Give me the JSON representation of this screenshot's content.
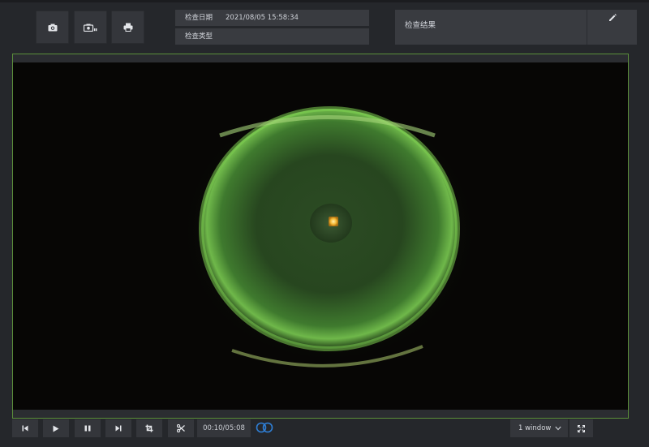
{
  "toolbar": {
    "buttons": [
      {
        "id": "capture",
        "icon": "camera-icon"
      },
      {
        "id": "record",
        "icon": "camera-record-icon"
      },
      {
        "id": "print",
        "icon": "printer-icon"
      }
    ]
  },
  "exam_info": {
    "date_label": "检查日期",
    "date_value": "2021/08/05 15:58:34",
    "type_label": "检查类型",
    "type_value": ""
  },
  "result": {
    "label": "检查结果",
    "edit_icon": "pencil-icon"
  },
  "player": {
    "buttons": [
      {
        "id": "prev",
        "icon": "skip-previous-icon"
      },
      {
        "id": "play",
        "icon": "play-icon"
      },
      {
        "id": "pause",
        "icon": "pause-icon"
      },
      {
        "id": "next",
        "icon": "skip-next-icon"
      },
      {
        "id": "crop",
        "icon": "crop-icon"
      },
      {
        "id": "cut",
        "icon": "scissors-icon"
      }
    ],
    "time": "00:10/05:08",
    "loop_icon": "loop-icon",
    "window_select": "1 window",
    "fullscreen_icon": "fullscreen-icon"
  },
  "colors": {
    "background": "#25272b",
    "panel": "#393b40",
    "button": "#34363b",
    "viewer_border": "#5b8f3a",
    "accent_blue": "#2f7fd6"
  }
}
